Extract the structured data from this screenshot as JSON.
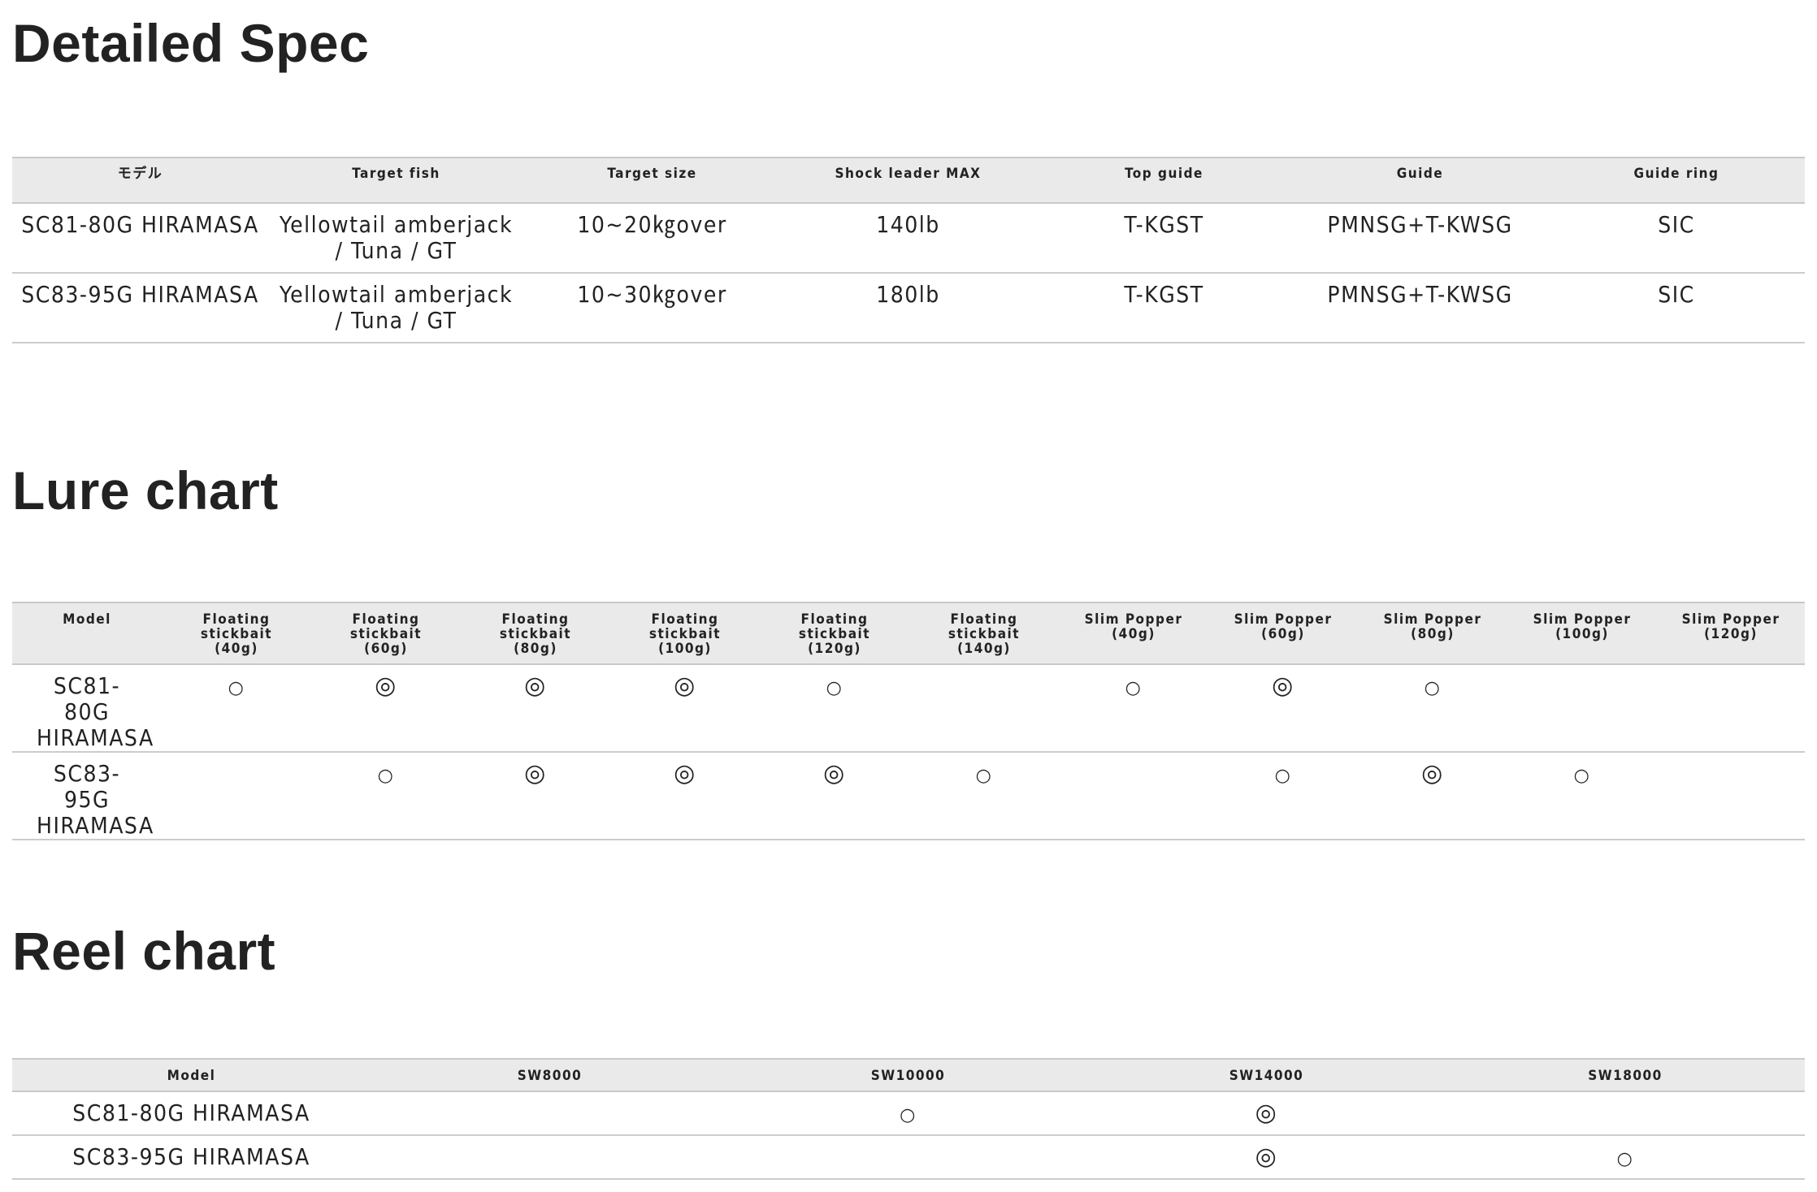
{
  "detailed_spec": {
    "title": "Detailed Spec",
    "headers": [
      "モデル",
      "Target fish",
      "Target size",
      "Shock leader MAX",
      "Top guide",
      "Guide",
      "Guide ring"
    ],
    "rows": [
      [
        "SC81-80G HIRAMASA",
        "Yellowtail amberjack / Tuna / GT",
        "10~20㎏over",
        "140lb",
        "T-KGST",
        "PMNSG+T-KWSG",
        "SIC"
      ],
      [
        "SC83-95G HIRAMASA",
        "Yellowtail amberjack / Tuna / GT",
        "10~30㎏over",
        "180lb",
        "T-KGST",
        "PMNSG+T-KWSG",
        "SIC"
      ]
    ]
  },
  "lure_chart": {
    "title": "Lure chart",
    "headers": [
      "Model",
      "Floating stickbait (40g)",
      "Floating stickbait (60g)",
      "Floating stickbait (80g)",
      "Floating stickbait (100g)",
      "Floating stickbait (120g)",
      "Floating stickbait (140g)",
      "Slim Popper (40g)",
      "Slim Popper (60g)",
      "Slim Popper (80g)",
      "Slim Popper (100g)",
      "Slim Popper (120g)"
    ],
    "rows": [
      [
        "SC81-80G HIRAMASA",
        "○",
        "◎",
        "◎",
        "◎",
        "○",
        "",
        "○",
        "◎",
        "○",
        "",
        ""
      ],
      [
        "SC83-95G HIRAMASA",
        "",
        "○",
        "◎",
        "◎",
        "◎",
        "○",
        "",
        "○",
        "◎",
        "○",
        ""
      ]
    ]
  },
  "reel_chart": {
    "title": "Reel chart",
    "headers": [
      "Model",
      "SW8000",
      "SW10000",
      "SW14000",
      "SW18000"
    ],
    "rows": [
      [
        "SC81-80G HIRAMASA",
        "",
        "○",
        "◎",
        ""
      ],
      [
        "SC83-95G HIRAMASA",
        "",
        "",
        "◎",
        "○"
      ]
    ]
  }
}
